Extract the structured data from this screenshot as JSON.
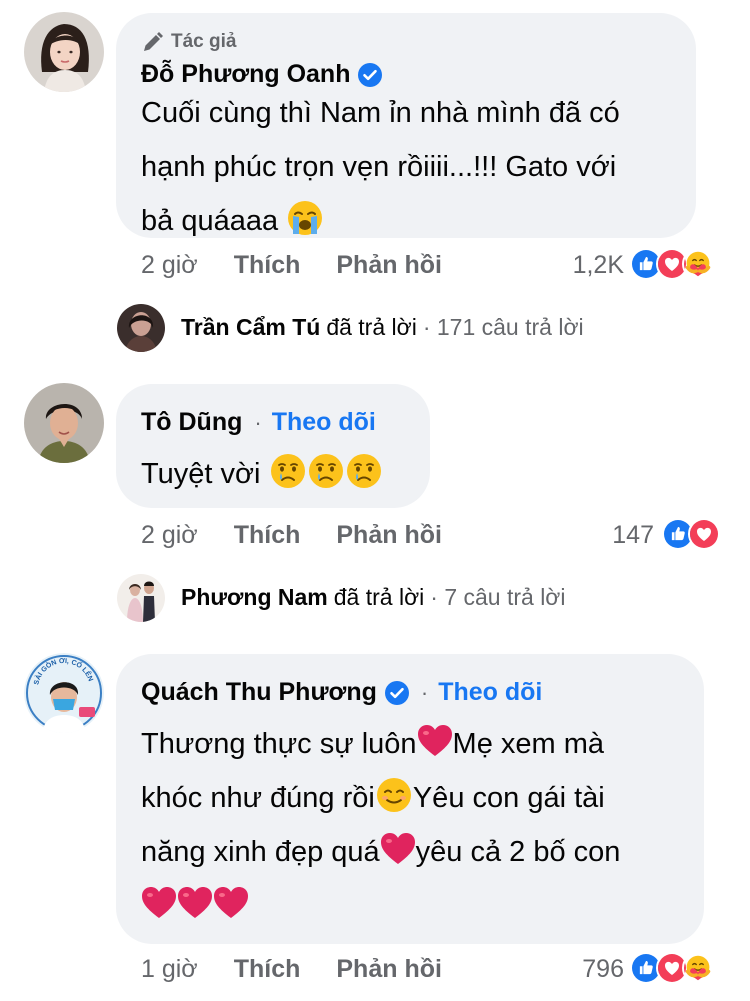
{
  "comments": [
    {
      "author_badge": "Tác giả",
      "name": "Đỗ Phương Oanh",
      "verified": true,
      "lines": [
        "Cuối cùng thì Nam ỉn nhà mình đã có",
        "hạnh phúc trọn vẹn rồiiii...!!! Gato với",
        "bả quáaaa"
      ],
      "time": "2 giờ",
      "like": "Thích",
      "reply": "Phản hồi",
      "reaction_count": "1,2K",
      "reactions": [
        "like",
        "love",
        "care"
      ],
      "replies_summary": {
        "name": "Trần Cẩm Tú",
        "text": "đã trả lời",
        "count": "· 171 câu trả lời"
      }
    },
    {
      "name": "Tô Dũng",
      "follow": "Theo dõi",
      "dot": "·",
      "lines": [
        "Tuyệt vời"
      ],
      "time": "2 giờ",
      "like": "Thích",
      "reply": "Phản hồi",
      "reaction_count": "147",
      "reactions": [
        "like",
        "love"
      ],
      "replies_summary": {
        "name": "Phương Nam",
        "text": "đã trả lời",
        "count": "· 7 câu trả lời"
      }
    },
    {
      "name": "Quách Thu Phương",
      "verified": true,
      "follow": "Theo dõi",
      "dot": "·",
      "lines": [
        "Thương thực sự luôn",
        "Mẹ xem mà",
        "khóc như đúng rồi",
        "Yêu con gái tài",
        "năng xinh đẹp quá",
        "yêu cả 2 bố con"
      ],
      "avatar_text": "SÀI GÒN ƠI, CỐ LÊN",
      "time": "1 giờ",
      "like": "Thích",
      "reply": "Phản hồi",
      "reaction_count": "796",
      "reactions": [
        "like",
        "love",
        "care"
      ]
    }
  ],
  "colors": {
    "bubble": "#f0f2f5",
    "link": "#1877f2",
    "meta": "#65676b",
    "like": "#1877f2",
    "love": "#f33e58",
    "heart_emoji": "#e0245e"
  },
  "icons": [
    "pen-icon",
    "verified-badge-icon",
    "loudly-crying-face-icon",
    "crying-face-icon",
    "red-heart-icon",
    "smiling-face-icon",
    "like-reaction-icon",
    "love-reaction-icon",
    "care-reaction-icon"
  ]
}
